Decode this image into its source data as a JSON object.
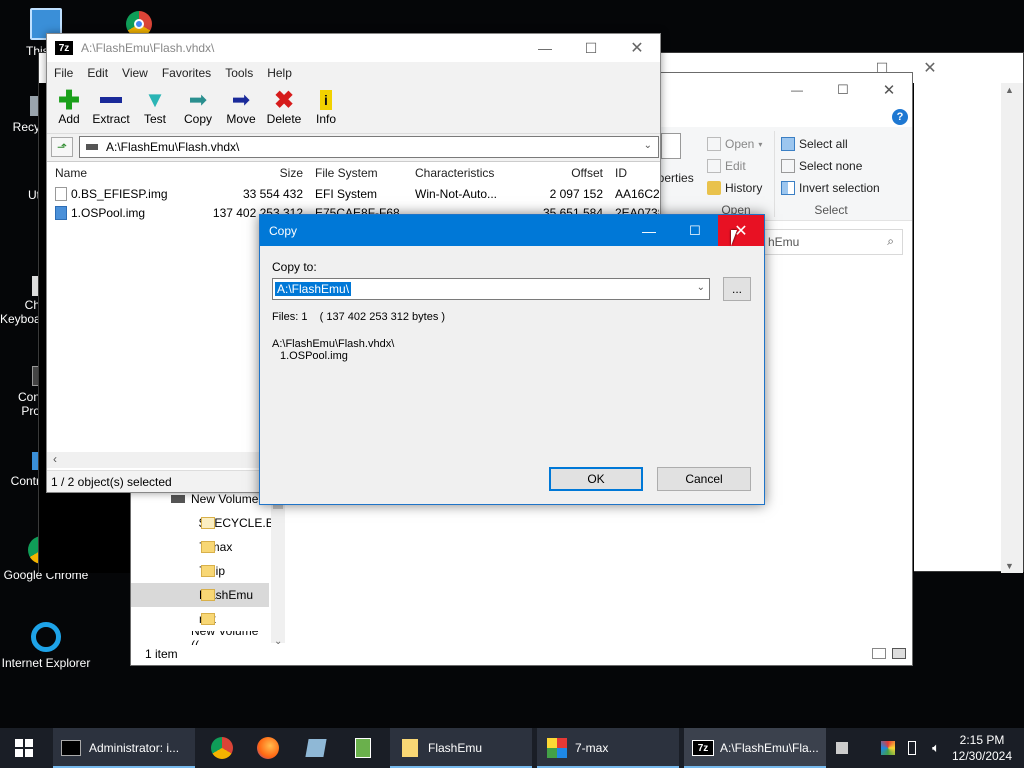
{
  "desktop": {
    "icons": [
      {
        "label": "This",
        "icon": "this-pc-icon"
      },
      {
        "label": "R",
        "icon": "recycle-bin-partial"
      },
      {
        "label": "Recy",
        "icon": "recycle-bin-icon"
      },
      {
        "label": "Ut",
        "icon": "utilities-icon"
      },
      {
        "label": "Ch",
        "icon": "charmap-icon"
      },
      {
        "label": "Keyboa",
        "icon": "keyboard-icon"
      },
      {
        "label": "Con",
        "icon": "console-icon"
      },
      {
        "label": "Pro",
        "icon": "console-icon"
      },
      {
        "label": "Contr",
        "icon": "control-panel-icon"
      },
      {
        "label": "Google Chrome",
        "icon": "chrome-icon"
      },
      {
        "label": "Internet Explorer",
        "icon": "ie-icon"
      }
    ]
  },
  "explorer": {
    "ribbon": {
      "open_label": "Open",
      "edit_label": "Edit",
      "history_label": "History",
      "group_open": "Open",
      "properties_label": "operties",
      "select_all": "Select all",
      "select_none": "Select none",
      "invert_selection": "Invert selection",
      "group_select": "Select"
    },
    "search_text": "hEmu",
    "nav": {
      "new_volume": "New Volume",
      "items": [
        "$RECYCLE.BIN",
        "7-max",
        "7-zip",
        "FlashEmu",
        "net"
      ],
      "selected": "FlashEmu",
      "partial": "New Volume (("
    },
    "status": "1 item"
  },
  "zip": {
    "title": "A:\\FlashEmu\\Flash.vhdx\\",
    "menu": [
      "File",
      "Edit",
      "View",
      "Favorites",
      "Tools",
      "Help"
    ],
    "toolbar": {
      "add": "Add",
      "extract": "Extract",
      "test": "Test",
      "copy": "Copy",
      "move": "Move",
      "delete": "Delete",
      "info": "Info"
    },
    "address": "A:\\FlashEmu\\Flash.vhdx\\",
    "columns": [
      "Name",
      "Size",
      "File System",
      "Characteristics",
      "Offset",
      "ID"
    ],
    "rows": [
      {
        "name": "0.BS_EFIESP.img",
        "size": "33 554 432",
        "fs": "EFI System",
        "chars": "Win-Not-Auto...",
        "offset": "2 097 152",
        "id": "AA16C2"
      },
      {
        "name": "1.OSPool.img",
        "size": "137 402 253 312",
        "fs": "E75CAE8F-F68",
        "chars": "",
        "offset": "35 651 584",
        "id": "2EA0738"
      }
    ],
    "status": "1 / 2 object(s) selected"
  },
  "dialog": {
    "title": "Copy",
    "copy_to_label": "Copy to:",
    "path_value": "A:\\FlashEmu\\",
    "browse_label": "...",
    "files_info": "Files: 1    ( 137 402 253 312 bytes )",
    "source_path": "A:\\FlashEmu\\Flash.vhdx\\",
    "source_file": "1.OSPool.img",
    "ok_label": "OK",
    "cancel_label": "Cancel"
  },
  "taskbar": {
    "items": [
      {
        "label": "Administrator: i...",
        "icon": "cmd-icon"
      },
      {
        "label": "FlashEmu",
        "icon": "folder-icon"
      },
      {
        "label": "7-max",
        "icon": "7max-icon"
      },
      {
        "label": "A:\\FlashEmu\\Fla...",
        "icon": "7zip-icon"
      }
    ],
    "time": "2:15 PM",
    "date": "12/30/2024"
  },
  "colors": {
    "accent": "#0078d7",
    "close_hover": "#e81123",
    "taskbar": "#1a1e26"
  }
}
